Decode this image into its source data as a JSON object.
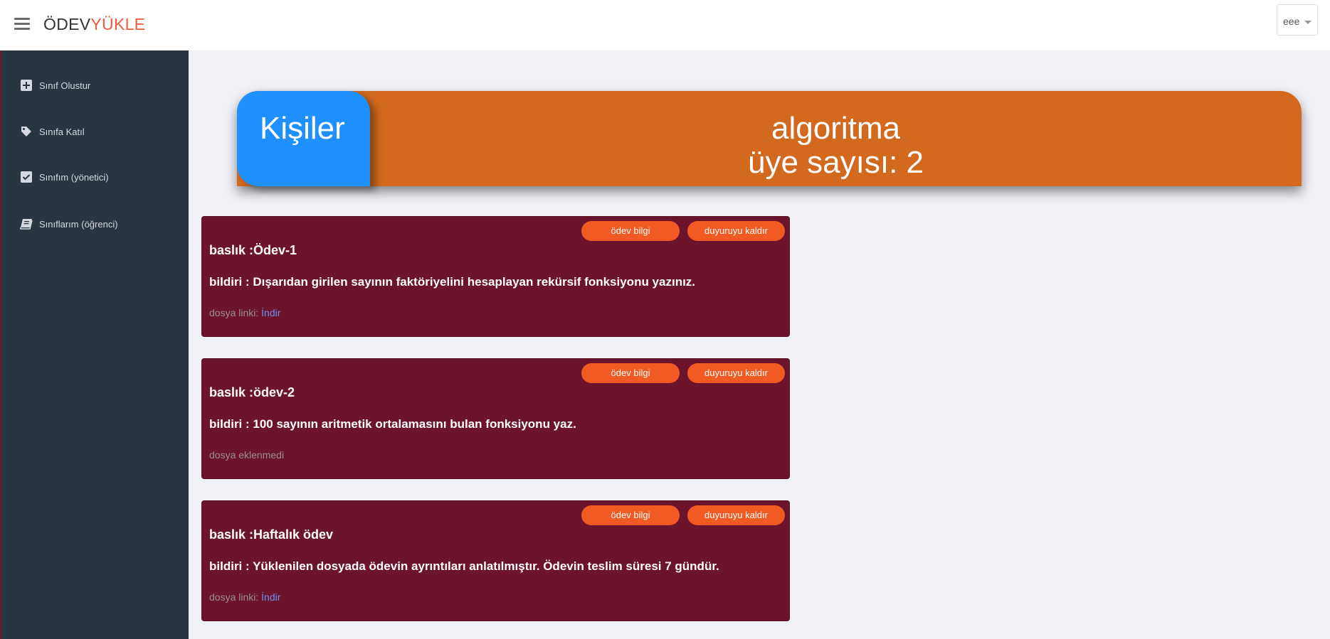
{
  "header": {
    "brand_part1": "ÖDEV",
    "brand_part2": "YÜKLE",
    "user_label": "eee"
  },
  "sidebar": {
    "items": [
      {
        "label": "Sınıf Olustur",
        "icon": "plus-square-icon"
      },
      {
        "label": "Sınıfa Katıl",
        "icon": "tag-icon"
      },
      {
        "label": "Sınıfım (yönetici)",
        "icon": "check-square-icon"
      },
      {
        "label": "Sınıflarım (öğrenci)",
        "icon": "book-icon"
      }
    ]
  },
  "banner": {
    "tab_label": "Kişiler",
    "class_name": "algoritma",
    "member_count_text": "üye sayısı: 2"
  },
  "assignments": [
    {
      "title": "baslık :Ödev-1",
      "body": "bildiri : Dışarıdan girilen sayının faktöriyelini hesaplayan rekürsif fonksiyonu yazınız.",
      "file_prefix": "dosya linki: ",
      "file_link": "İndir"
    },
    {
      "title": "baslık :ödev-2",
      "body": "bildiri : 100 sayının aritmetik ortalamasını bulan fonksiyonu yaz.",
      "file_text": "dosya eklenmedi"
    },
    {
      "title": "baslık :Haftalık ödev",
      "body": "bildiri : Yüklenilen dosyada ödevin ayrıntıları anlatılmıştır. Ödevin teslim süresi 7 gündür.",
      "file_prefix": "dosya linki: ",
      "file_link": "İndir"
    }
  ],
  "buttons": {
    "info_label": "ödev bilgi",
    "remove_label": "duyuruyu kaldır"
  },
  "colors": {
    "brand_accent": "#f05a3e",
    "sidebar_bg": "#2a3542",
    "banner_orange": "#d2691e",
    "banner_tab_blue": "#1e90ff",
    "card_bg": "#6d142d",
    "button_bg": "#f15a22",
    "link": "#6f8fe8"
  }
}
